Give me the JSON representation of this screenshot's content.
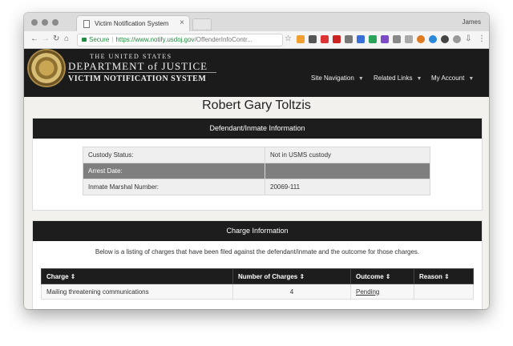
{
  "browser": {
    "tab_title": "Victim Notification System",
    "user": "James",
    "secure_label": "Secure",
    "url_host": "https://www.notify.usdoj.gov",
    "url_path": "/OffenderInfoContr..."
  },
  "header": {
    "doj_line1": "THE UNITED STATES",
    "doj_line2": "DEPARTMENT of JUSTICE",
    "doj_line3": "VICTIM NOTIFICATION SYSTEM",
    "nav": [
      "Site Navigation",
      "Related Links",
      "My Account"
    ]
  },
  "person_name": "Robert Gary Toltzis",
  "defendant_panel": {
    "title": "Defendant/Inmate Information",
    "rows": [
      {
        "label": "Custody Status:",
        "value": "Not in USMS custody"
      },
      {
        "label": "Arrest Date:",
        "value": ""
      },
      {
        "label": "Inmate Marshal Number:",
        "value": "20069-111"
      }
    ]
  },
  "charge_panel": {
    "title": "Charge Information",
    "description": "Below is a listing of charges that have been filed against the defendant/inmate and the outcome for those charges.",
    "columns": [
      "Charge ⇕",
      "Number of Charges ⇕",
      "Outcome ⇕",
      "Reason ⇕"
    ],
    "rows": [
      {
        "charge": "Mailing threatening communications",
        "count": "4",
        "outcome": "Pending",
        "reason": ""
      }
    ]
  },
  "colors": {
    "secure_green": "#1e8e3e",
    "banner_black": "#1b1b1b"
  }
}
